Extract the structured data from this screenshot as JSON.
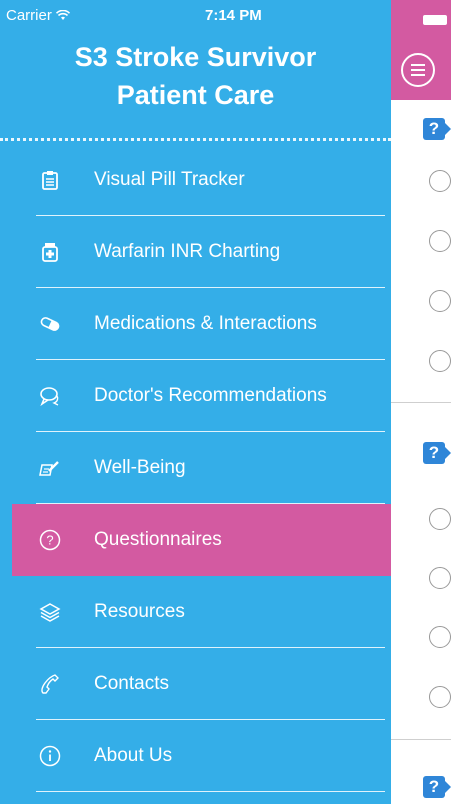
{
  "status_bar": {
    "carrier": "Carrier",
    "time": "7:14 PM"
  },
  "app": {
    "title_line1": "S3 Stroke Survivor",
    "title_line2": "Patient Care"
  },
  "menu": [
    {
      "label": "Visual Pill Tracker",
      "icon": "clipboard-icon"
    },
    {
      "label": "Warfarin INR Charting",
      "icon": "pill-bottle-icon"
    },
    {
      "label": "Medications & Interactions",
      "icon": "capsule-icon"
    },
    {
      "label": "Doctor's Recommendations",
      "icon": "chat-bubbles-icon"
    },
    {
      "label": "Well-Being",
      "icon": "notepad-pencil-icon"
    },
    {
      "label": "Questionnaires",
      "icon": "question-circle-icon",
      "active": true
    },
    {
      "label": "Resources",
      "icon": "layers-icon"
    },
    {
      "label": "Contacts",
      "icon": "phone-icon"
    },
    {
      "label": "About Us",
      "icon": "info-circle-icon"
    }
  ],
  "colors": {
    "sidebar": "#34aee8",
    "accent": "#d35aa1",
    "question_badge": "#2f86d8"
  },
  "peek": {
    "question_badge": "?"
  }
}
